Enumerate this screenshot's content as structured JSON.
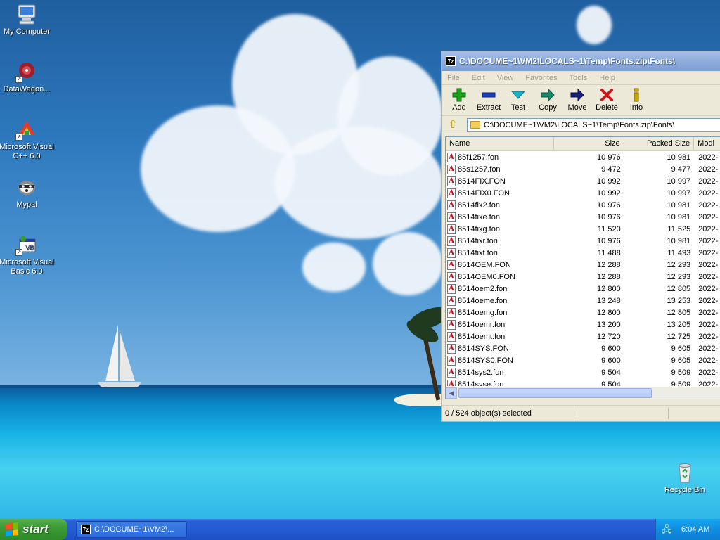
{
  "desktop": {
    "icons": [
      {
        "label": "My Computer",
        "icon": "my-computer-icon"
      },
      {
        "label": "DataWagon...",
        "icon": "datawagon-icon"
      },
      {
        "label": "Microsoft Visual C++ 6.0",
        "icon": "visual-cpp-icon"
      },
      {
        "label": "Mypal",
        "icon": "mypal-icon"
      },
      {
        "label": "Microsoft Visual Basic 6.0",
        "icon": "visual-basic-icon"
      },
      {
        "label": "Recycle Bin",
        "icon": "recycle-bin-icon"
      }
    ]
  },
  "window": {
    "title": "C:\\DOCUME~1\\VM2\\LOCALS~1\\Temp\\Fonts.zip\\Fonts\\",
    "logo": "7z",
    "menu": [
      "File",
      "Edit",
      "View",
      "Favorites",
      "Tools",
      "Help"
    ],
    "toolbar": [
      {
        "label": "Add",
        "icon": "add-icon",
        "color": "#1aa41a"
      },
      {
        "label": "Extract",
        "icon": "extract-icon",
        "color": "#1c3fb8"
      },
      {
        "label": "Test",
        "icon": "test-icon",
        "color": "#19b0c8"
      },
      {
        "label": "Copy",
        "icon": "copy-icon",
        "color": "#1a8a6a"
      },
      {
        "label": "Move",
        "icon": "move-icon",
        "color": "#15207a"
      },
      {
        "label": "Delete",
        "icon": "delete-icon",
        "color": "#d0141c"
      },
      {
        "label": "Info",
        "icon": "info-icon",
        "color": "#c8a800"
      }
    ],
    "address": "C:\\DOCUME~1\\VM2\\LOCALS~1\\Temp\\Fonts.zip\\Fonts\\",
    "columns": [
      "Name",
      "Size",
      "Packed Size",
      "Modi"
    ],
    "files": [
      {
        "name": "85f1257.fon",
        "size": "10 976",
        "packed": "10 981",
        "modified": "2022-"
      },
      {
        "name": "85s1257.fon",
        "size": "9 472",
        "packed": "9 477",
        "modified": "2022-"
      },
      {
        "name": "8514FIX.FON",
        "size": "10 992",
        "packed": "10 997",
        "modified": "2022-"
      },
      {
        "name": "8514FIX0.FON",
        "size": "10 992",
        "packed": "10 997",
        "modified": "2022-"
      },
      {
        "name": "8514fix2.fon",
        "size": "10 976",
        "packed": "10 981",
        "modified": "2022-"
      },
      {
        "name": "8514fixe.fon",
        "size": "10 976",
        "packed": "10 981",
        "modified": "2022-"
      },
      {
        "name": "8514fixg.fon",
        "size": "11 520",
        "packed": "11 525",
        "modified": "2022-"
      },
      {
        "name": "8514fixr.fon",
        "size": "10 976",
        "packed": "10 981",
        "modified": "2022-"
      },
      {
        "name": "8514fixt.fon",
        "size": "11 488",
        "packed": "11 493",
        "modified": "2022-"
      },
      {
        "name": "8514OEM.FON",
        "size": "12 288",
        "packed": "12 293",
        "modified": "2022-"
      },
      {
        "name": "8514OEM0.FON",
        "size": "12 288",
        "packed": "12 293",
        "modified": "2022-"
      },
      {
        "name": "8514oem2.fon",
        "size": "12 800",
        "packed": "12 805",
        "modified": "2022-"
      },
      {
        "name": "8514oeme.fon",
        "size": "13 248",
        "packed": "13 253",
        "modified": "2022-"
      },
      {
        "name": "8514oemg.fon",
        "size": "12 800",
        "packed": "12 805",
        "modified": "2022-"
      },
      {
        "name": "8514oemr.fon",
        "size": "13 200",
        "packed": "13 205",
        "modified": "2022-"
      },
      {
        "name": "8514oemt.fon",
        "size": "12 720",
        "packed": "12 725",
        "modified": "2022-"
      },
      {
        "name": "8514SYS.FON",
        "size": "9 600",
        "packed": "9 605",
        "modified": "2022-"
      },
      {
        "name": "8514SYS0.FON",
        "size": "9 600",
        "packed": "9 605",
        "modified": "2022-"
      },
      {
        "name": "8514sys2.fon",
        "size": "9 504",
        "packed": "9 509",
        "modified": "2022-"
      },
      {
        "name": "8514syse.fon",
        "size": "9 504",
        "packed": "9 509",
        "modified": "2022-"
      }
    ],
    "status": "0 / 524 object(s) selected"
  },
  "taskbar": {
    "start_label": "start",
    "task_label": "C:\\DOCUME~1\\VM2\\...",
    "task_logo": "7z",
    "clock": "6:04 AM"
  }
}
